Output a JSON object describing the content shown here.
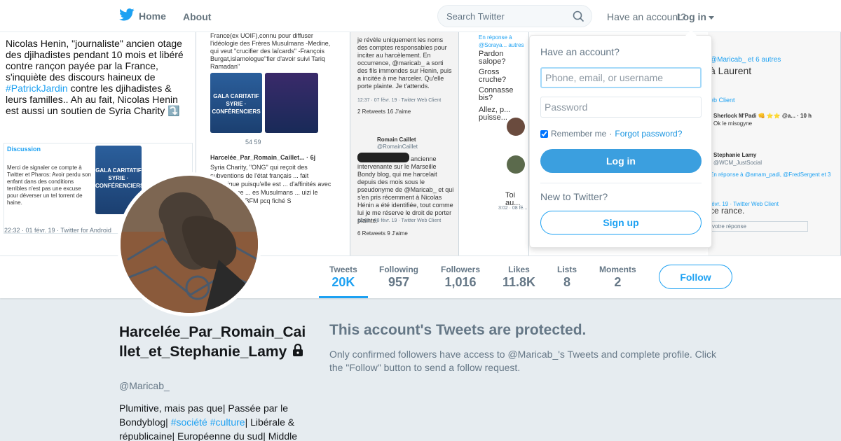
{
  "nav": {
    "home_label": "Home",
    "about_label": "About",
    "search_placeholder": "Search Twitter",
    "have_account": "Have an account?",
    "login_label": "Log in"
  },
  "banner": {
    "panel1_text_before": "Nicolas Henin, \"journaliste\" ancien otage des djihadistes pendant 10 mois et libéré contre rançon payée par la France, s'inquiète des discours haineux de ",
    "panel1_hashtag": "#PatrickJardin",
    "panel1_text_after": " contre les djihadistes & leurs familles.. Ah au fait, Nicolas Henin est aussi un soutien de Syria Charity ⤵️",
    "panel1_discussion": "Discussion",
    "panel1_quoted": "Merci de signaler ce compte à Twitter et Pharos: Avoir perdu son enfant dans des conditions terribles n'est pas une excuse pour déverser un tel torrent de haine.",
    "panel1_poster": "GALA CARITATIF SYRIE · CONFÉRENCIERS",
    "panel1_footer": "22:32 · 01 févr. 19 · Twitter for Android",
    "panel2_top": "France(ex UOIF),connu pour diffuser l'idéologie des Frères Musulmans -Medine, qui veut \"crucifier des laïcards\" -François Burgat,islamologue\"fier d'avoir suivi Tariq Ramadan\"",
    "panel2_poster": "GALA CARITATIF SYRIE · CONFÉRENCIERS",
    "panel2_counts": "54   59",
    "panel2_author": "Harcelée_Par_Romain_Caillet... · 6j",
    "panel2_body": "Syria Charity, \"ONG\" qui reçoit des subventions de l'état français ... fait polémique puisqu'elle est ... d'affinités avec le salafisme ... es Musulmans ... uizi le pense ... de BFM pcq fiché S",
    "panel3_top": "je révèle uniquement les noms des comptes responsables pour inciter au harcèlement. En occurrence, @maricab_ a sorti des fils immondes sur Henin, puis a incitée à me harceler. Qu'elle porte plainte. Je t'attends.",
    "panel3_meta": "12:37 · 07 févr. 19 · Twitter Web Client",
    "panel3_stats": "2 Retweets   16 J'aime",
    "panel3_author": "Romain Caillet",
    "panel3_handle": "@RomainCaillet",
    "panel3_body": "ancienne intervenante sur le Marseille Bondy blog, qui me harcelait depuis des mois sous le pseudonyme de @Maricab_ et qui s'en pris récemment à Nicolas Hénin a été identifiée, tout comme lui je me réserve le droit de porter plainte.",
    "panel3_meta2": "12:13 · 08 févr. 19 · Twitter Web Client",
    "panel3_stats2": "6 Retweets   9 J'aime",
    "panel4_reply": "En réponse à @Soraya... autres",
    "panel4_lines": [
      "Pardon salope?",
      "Gross cruche?",
      "Connasse bis?",
      "Allez, p... puisse..."
    ],
    "panel4_toi": "Toi au...",
    "panel4_meta": "3:02 · 08 fé...",
    "panel5_top": "@Maricab_ et 6 autres",
    "panel5_laurent": "à Laurent",
    "panel5_client": "eb Client",
    "panel5_user1": "Sherlock M'Padi 👊 ⭐⭐ @a... · 10 h",
    "panel5_user1_text": "Ok le misogyne",
    "panel5_user2": "Stephanie Lamy",
    "panel5_user2_handle": "@WCM_JustSocial",
    "panel5_reply": "En réponse à @amam_padi, @FredSergent et 3",
    "panel5_text": "ce rance.",
    "panel5_meta": "févr. 19 · Twitter Web Client",
    "panel5_input": "votre réponse"
  },
  "stats": [
    {
      "label": "Tweets",
      "value": "20K"
    },
    {
      "label": "Following",
      "value": "957"
    },
    {
      "label": "Followers",
      "value": "1,016"
    },
    {
      "label": "Likes",
      "value": "11.8K"
    },
    {
      "label": "Lists",
      "value": "8"
    },
    {
      "label": "Moments",
      "value": "2"
    }
  ],
  "follow_label": "Follow",
  "profile": {
    "name": "Harcelée_Par_Romain_Caillet_et_Stephanie_Lamy",
    "handle": "@Maricab_",
    "bio_1": "Plumitive, mais pas que| Passée par le Bondyblog| ",
    "bio_tag1": "#société",
    "bio_tag2": "#culture",
    "bio_2": "| Libérale & républicaine| Européenne du sud| Middle"
  },
  "protected": {
    "title": "This account's Tweets are protected.",
    "text": "Only confirmed followers have access to @Maricab_'s Tweets and complete profile. Click the \"Follow\" button to send a follow request."
  },
  "login_dropdown": {
    "title": "Have an account?",
    "username_placeholder": "Phone, email, or username",
    "password_placeholder": "Password",
    "remember_label": "Remember me",
    "separator": " · ",
    "forgot_label": "Forgot password?",
    "login_button": "Log in",
    "new_to": "New to Twitter?",
    "signup_button": "Sign up"
  },
  "colors": {
    "brand": "#1da1f2",
    "background": "#e6ecf0",
    "muted": "#657786"
  }
}
